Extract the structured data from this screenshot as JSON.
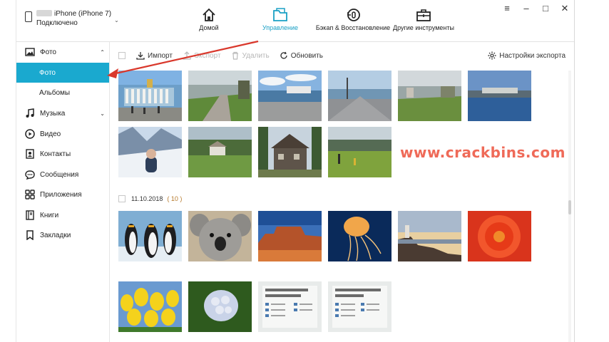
{
  "device": {
    "name": "iPhone (iPhone 7)",
    "status": "Подключено"
  },
  "nav": [
    {
      "label": "Домой",
      "icon": "home-icon"
    },
    {
      "label": "Управление",
      "icon": "folder-icon",
      "active": true
    },
    {
      "label": "Бэкап & Восстановление",
      "icon": "backup-icon"
    },
    {
      "label": "Другие инструменты",
      "icon": "toolbox-icon"
    }
  ],
  "window_controls": {
    "menu": "≡",
    "minimize": "–",
    "maximize": "□",
    "close": "✕"
  },
  "sidebar": {
    "photos_group": "Фото",
    "photos_sub": "Фото",
    "albums_sub": "Альбомы",
    "music": "Музыка",
    "video": "Видео",
    "contacts": "Контакты",
    "messages": "Сообщения",
    "apps": "Приложения",
    "books": "Книги",
    "bookmarks": "Закладки"
  },
  "toolbar": {
    "import": "Импорт",
    "export": "Экспорт",
    "delete": "Удалить",
    "refresh": "Обновить",
    "export_settings": "Настройки экспорта"
  },
  "group": {
    "date": "11.10.2018",
    "count": "( 10 )"
  },
  "watermark": "www.crackbins.com",
  "accent_color": "#1aa9cf"
}
